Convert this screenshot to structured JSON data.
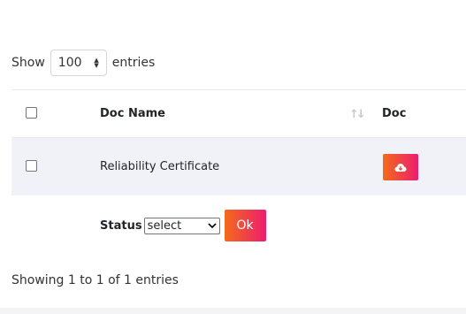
{
  "length_menu": {
    "prefix": "Show",
    "selected": "100",
    "suffix": "entries"
  },
  "table": {
    "columns": [
      "Doc Name",
      "Doc"
    ],
    "rows": [
      {
        "doc_name": "Reliability Certificate",
        "download_icon": "cloud-download-icon"
      }
    ]
  },
  "status_form": {
    "label": "Status",
    "select_value": "select",
    "ok_label": "Ok"
  },
  "info": "Showing 1 to 1 of 1 entries",
  "colors": {
    "button_gradient_start": "#f46a1b",
    "button_gradient_end": "#ec1e6f",
    "row_highlight": "#f1f2f8"
  }
}
